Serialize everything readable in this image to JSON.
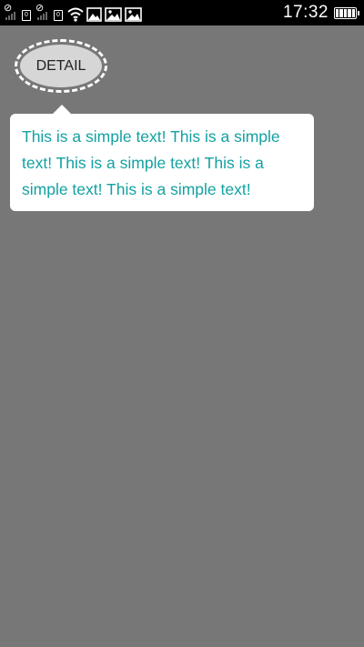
{
  "status_bar": {
    "time": "17:32",
    "sim1_label": "0",
    "sim2_label": "0",
    "icons": [
      "sim1-signal-icon",
      "sim2-signal-icon",
      "wifi-icon",
      "image-notification-icon",
      "image-notification-icon",
      "image-notification-icon",
      "battery-icon"
    ]
  },
  "detail_button": {
    "label": "DETAIL"
  },
  "tooltip": {
    "text": "This is a simple text! This is a simple text! This is a simple text! This is a simple text! This is a simple text!"
  },
  "colors": {
    "background": "#777777",
    "tooltip_text": "#15a1a2",
    "button_fill": "#d6d6d6",
    "status_bar": "#000000"
  }
}
